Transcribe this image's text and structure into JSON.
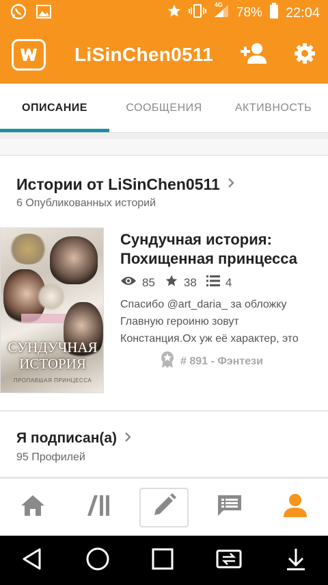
{
  "status_bar": {
    "battery_percent": "78%",
    "time": "22:04",
    "network": "4G",
    "icons": [
      "whatsapp-icon",
      "gallery-icon",
      "star-icon",
      "vibrate-icon",
      "signal-icon",
      "battery-icon"
    ]
  },
  "app_bar": {
    "logo": "W",
    "title": "LiSinChen0511",
    "actions": [
      "add-person-icon",
      "settings-icon"
    ]
  },
  "tabs": [
    {
      "label": "ОПИСАНИЕ",
      "active": true
    },
    {
      "label": "СООБЩЕНИЯ",
      "active": false
    },
    {
      "label": "АКТИВНОСТЬ",
      "active": false
    }
  ],
  "stories_section": {
    "title": "Истории от LiSinChen0511",
    "subtitle": "6 Опубликованных историй",
    "story": {
      "cover_title_line1": "СУНДУЧНАЯ",
      "cover_title_line2": "ИСТОРИЯ",
      "cover_subtitle": "ПРОПАВШАЯ ПРИНЦЕССА",
      "title_line1": "Сундучная история:",
      "title_line2": "Похищенная принцесса",
      "reads": "85",
      "votes": "38",
      "parts": "4",
      "desc_line1": "Спасибо @art_daria_  за обложку",
      "desc_line2": "Главную героиню зовут",
      "desc_line3": "Констанция.Ох уж её характер, это",
      "rank": "# 891 - Фэнтези"
    }
  },
  "following_section": {
    "title": "Я подписан(а)",
    "subtitle": "95 Профилей"
  },
  "bottom_nav": [
    "home-icon",
    "library-icon",
    "write-icon",
    "messages-icon",
    "profile-icon"
  ],
  "colors": {
    "accent": "#f7941e",
    "tab_indicator": "#1a8fa3",
    "nav_inactive": "#8a8a8a"
  }
}
